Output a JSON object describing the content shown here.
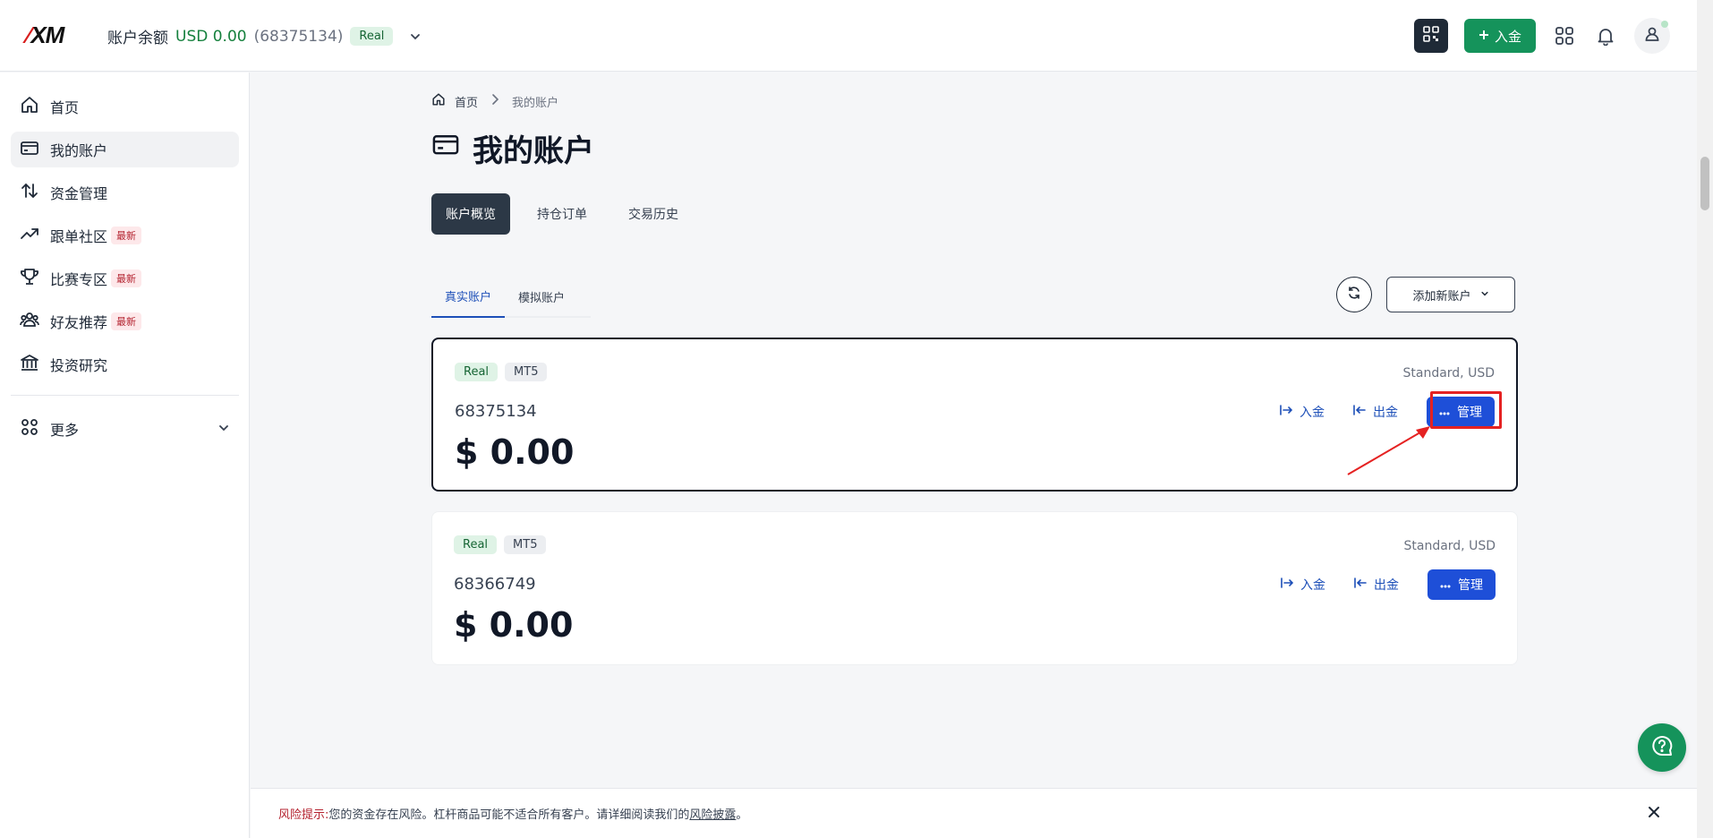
{
  "topbar": {
    "logo": "XM",
    "balance_label": "账户余额",
    "balance_amount": "USD 0.00",
    "account_number": "(68375134)",
    "account_badge": "Real",
    "deposit_label": "入金",
    "icons": [
      "qr-code-icon",
      "plus-icon",
      "apps-grid-icon",
      "bell-icon",
      "user-icon",
      "chevron-down-icon"
    ]
  },
  "sidebar": {
    "items": [
      {
        "label": "首页",
        "icon": "home-icon"
      },
      {
        "label": "我的账户",
        "icon": "wallet-icon",
        "active": true
      },
      {
        "label": "资金管理",
        "icon": "transfer-icon"
      },
      {
        "label": "跟单社区",
        "icon": "trend-up-icon",
        "badge": "最新"
      },
      {
        "label": "比赛专区",
        "icon": "trophy-icon",
        "badge": "最新"
      },
      {
        "label": "好友推荐",
        "icon": "users-icon",
        "badge": "最新"
      },
      {
        "label": "投资研究",
        "icon": "bank-icon"
      }
    ],
    "more_label": "更多"
  },
  "breadcrumb": {
    "home": "首页",
    "current": "我的账户"
  },
  "page_title": "我的账户",
  "tabs": [
    "账户概览",
    "持仓订单",
    "交易历史"
  ],
  "subtabs": [
    "真实账户",
    "模拟账户"
  ],
  "add_account_label": "添加新账户",
  "accounts": [
    {
      "tags": [
        "Real",
        "MT5"
      ],
      "type": "Standard, USD",
      "number": "68375134",
      "balance": "$ 0.00",
      "deposit": "入金",
      "withdraw": "出金",
      "manage": "管理",
      "selected": true
    },
    {
      "tags": [
        "Real",
        "MT5"
      ],
      "type": "Standard, USD",
      "number": "68366749",
      "balance": "$ 0.00",
      "deposit": "入金",
      "withdraw": "出金",
      "manage": "管理",
      "selected": false
    }
  ],
  "risk": {
    "label": "风险提示:",
    "text": " 您的资金存在风险。杠杆商品可能不适合所有客户。请详细阅读我们的",
    "link": "风险披露",
    "end": "。"
  },
  "colors": {
    "brand_green": "#15935b",
    "accent_blue": "#1e4fd8",
    "annotation_red": "#e52222"
  }
}
